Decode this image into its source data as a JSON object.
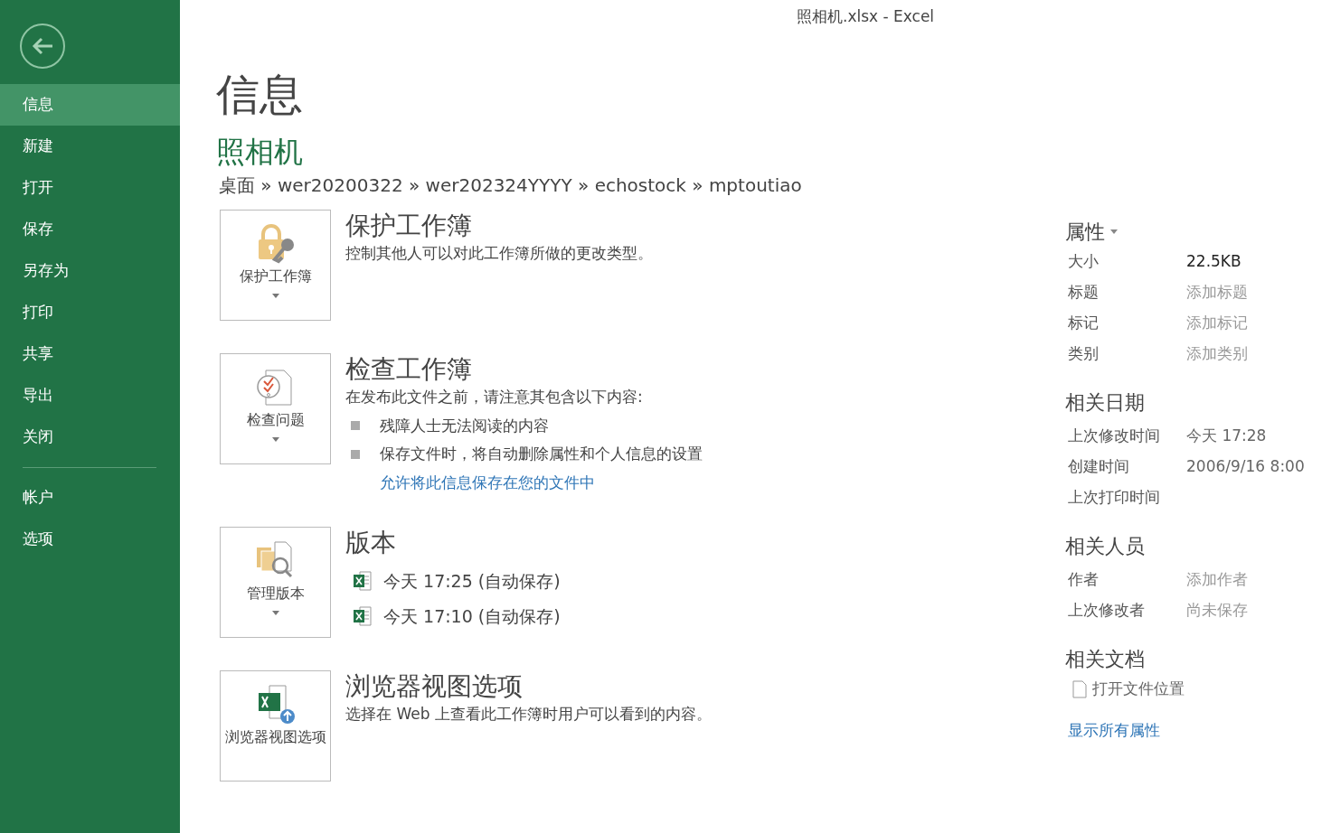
{
  "window": {
    "title": "照相机.xlsx - Excel"
  },
  "sidebar": {
    "groups": [
      [
        {
          "label": "信息",
          "selected": true
        },
        {
          "label": "新建",
          "selected": false
        },
        {
          "label": "打开",
          "selected": false
        },
        {
          "label": "保存",
          "selected": false
        },
        {
          "label": "另存为",
          "selected": false
        },
        {
          "label": "打印",
          "selected": false
        },
        {
          "label": "共享",
          "selected": false
        },
        {
          "label": "导出",
          "selected": false
        },
        {
          "label": "关闭",
          "selected": false
        }
      ],
      [
        {
          "label": "帐户",
          "selected": false
        },
        {
          "label": "选项",
          "selected": false
        }
      ]
    ]
  },
  "page": {
    "heading": "信息",
    "file_name": "照相机",
    "path": "桌面 » wer20200322 » wer202324YYYY » echostock » mptoutiao"
  },
  "sections": [
    {
      "kind": "lock",
      "button": "保护工作簿",
      "dropdown": true,
      "title": "保护工作簿",
      "description": "控制其他人可以对此工作簿所做的更改类型。"
    },
    {
      "kind": "inspect",
      "button": "检查问题",
      "dropdown": true,
      "title": "检查工作簿",
      "description": "在发布此文件之前，请注意其包含以下内容:",
      "bullets": [
        "残障人士无法阅读的内容",
        "保存文件时，将自动删除属性和个人信息的设置"
      ],
      "link": "允许将此信息保存在您的文件中"
    },
    {
      "kind": "versions",
      "button": "管理版本",
      "dropdown": true,
      "title": "版本",
      "versions": [
        "今天 17:25 (自动保存)",
        "今天 17:10 (自动保存)"
      ]
    },
    {
      "kind": "browser",
      "button": "浏览器视图选项",
      "dropdown": false,
      "title": "浏览器视图选项",
      "description": "选择在 Web 上查看此工作簿时用户可以看到的内容。"
    }
  ],
  "properties": {
    "title": "属性",
    "groups": [
      {
        "rows": [
          {
            "label": "大小",
            "value": "22.5KB"
          },
          {
            "label": "标题",
            "placeholder": "添加标题"
          },
          {
            "label": "标记",
            "placeholder": "添加标记"
          },
          {
            "label": "类别",
            "placeholder": "添加类别"
          }
        ]
      },
      {
        "heading": "相关日期",
        "rows": [
          {
            "label": "上次修改时间",
            "value": "今天 17:28"
          },
          {
            "label": "创建时间",
            "value": "2006/9/16 8:00"
          },
          {
            "label": "上次打印时间"
          }
        ]
      },
      {
        "heading": "相关人员",
        "rows": [
          {
            "label": "作者",
            "placeholder": "添加作者"
          },
          {
            "label": "上次修改者",
            "placeholder": "尚未保存"
          }
        ]
      },
      {
        "heading": "相关文档",
        "files": [
          "打开文件位置"
        ]
      }
    ],
    "link": "显示所有属性"
  }
}
